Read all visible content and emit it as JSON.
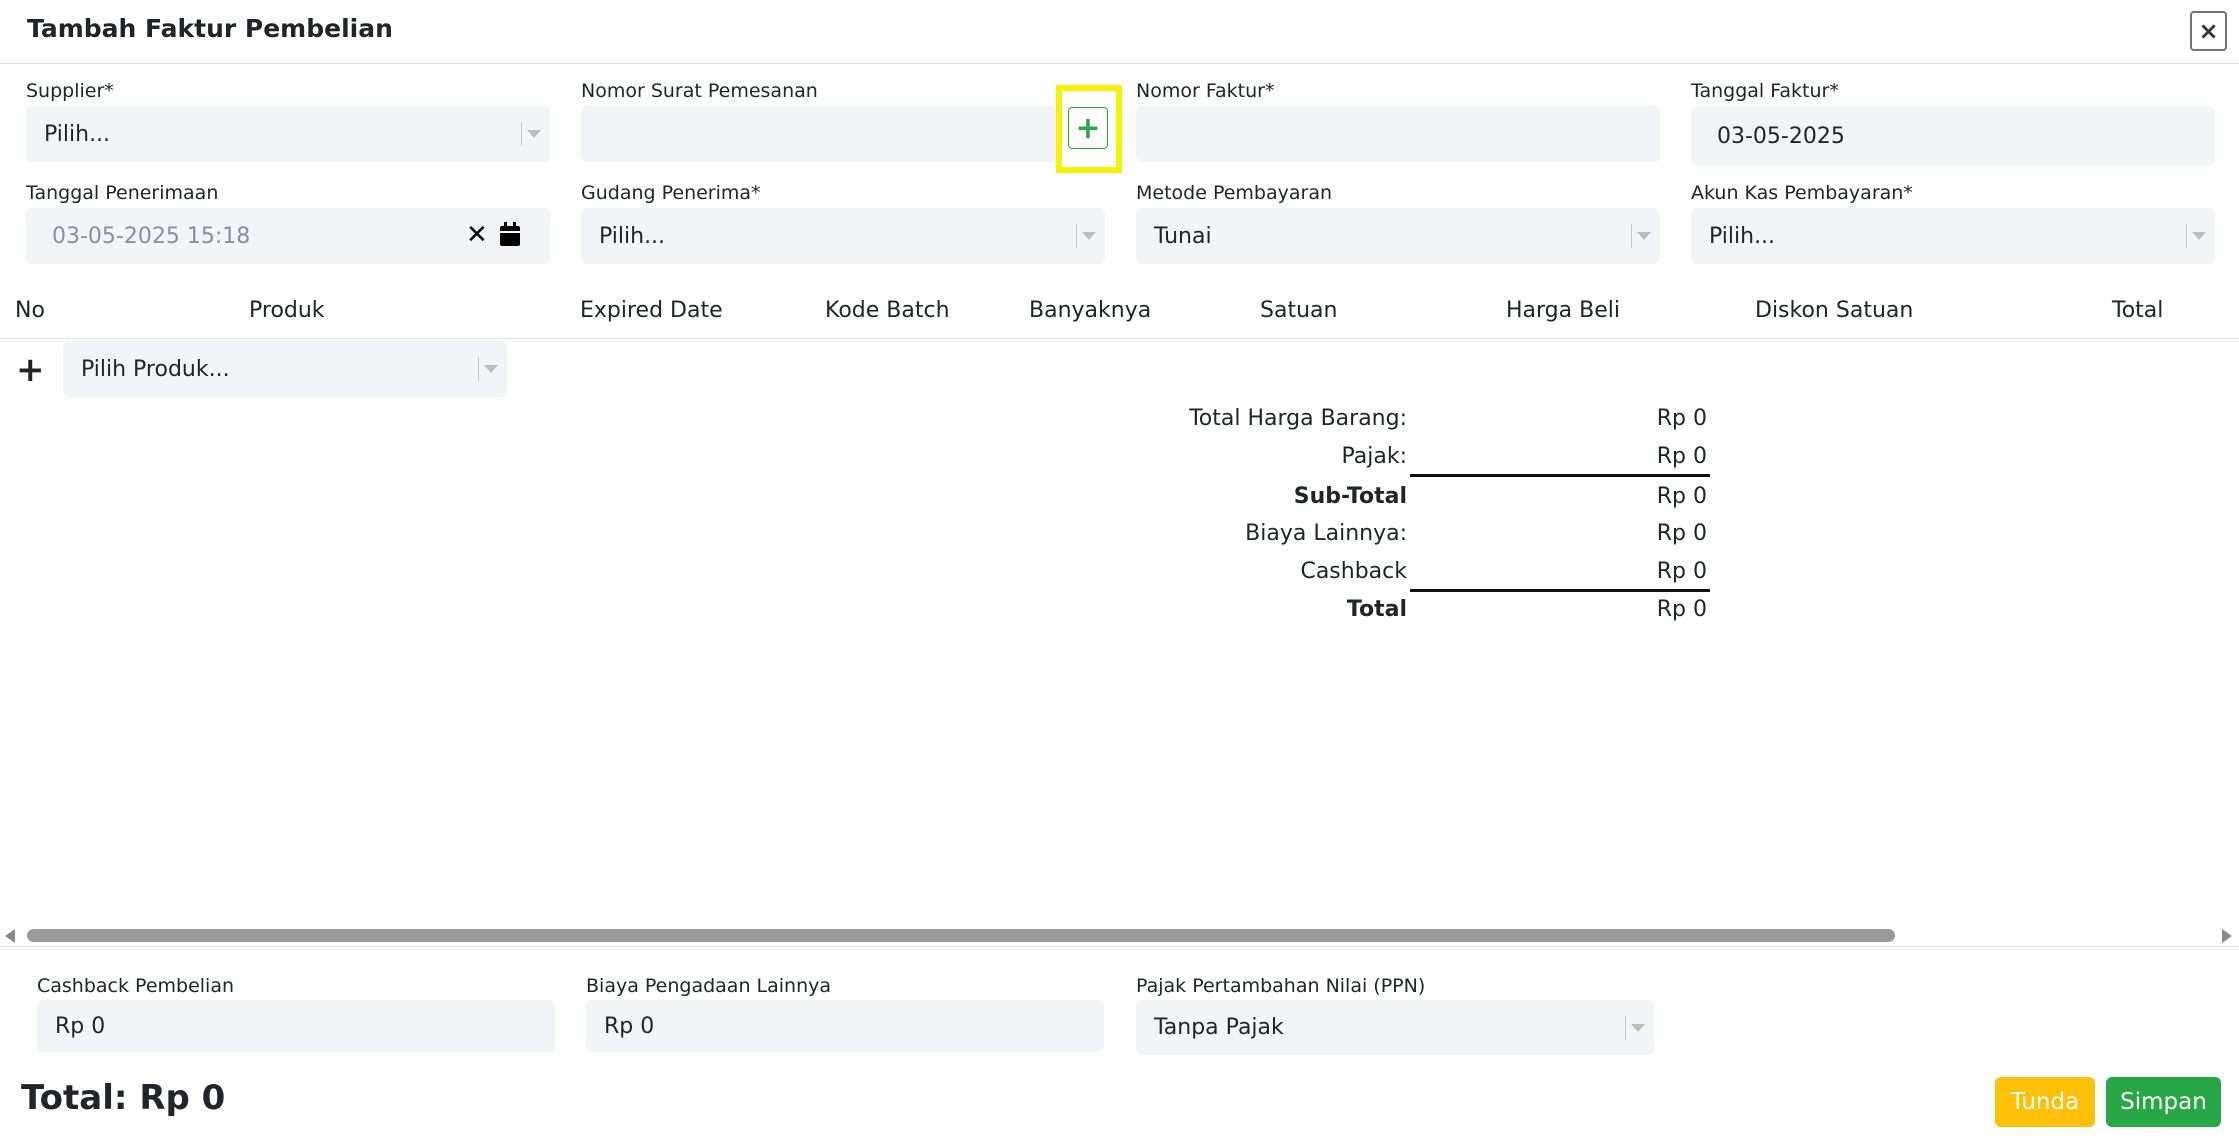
{
  "header": {
    "title": "Tambah Faktur Pembelian",
    "close_icon": "close-icon"
  },
  "form": {
    "supplier": {
      "label": "Supplier*",
      "value": "Pilih..."
    },
    "nomor_surat": {
      "label": "Nomor Surat Pemesanan",
      "value": "",
      "add_label": "+"
    },
    "nomor_faktur": {
      "label": "Nomor Faktur*",
      "value": ""
    },
    "tanggal_faktur": {
      "label": "Tanggal Faktur*",
      "value": "03-05-2025"
    },
    "tanggal_penerimaan": {
      "label": "Tanggal Penerimaan",
      "value": "03-05-2025 15:18",
      "clear_icon": "close-icon",
      "calendar_icon": "calendar-icon"
    },
    "gudang": {
      "label": "Gudang Penerima*",
      "value": "Pilih..."
    },
    "metode": {
      "label": "Metode Pembayaran",
      "value": "Tunai"
    },
    "akun_kas": {
      "label": "Akun Kas Pembayaran*",
      "value": "Pilih..."
    }
  },
  "table": {
    "columns": [
      "No",
      "Produk",
      "Expired Date",
      "Kode Batch",
      "Banyaknya",
      "Satuan",
      "Harga Beli",
      "Diskon Satuan",
      "Total"
    ],
    "add_row_label": "+",
    "product_select": "Pilih Produk..."
  },
  "summary": [
    {
      "label": "Total Harga Barang:",
      "value": "Rp 0"
    },
    {
      "label": "Pajak:",
      "value": "Rp 0"
    },
    {
      "label": "Sub-Total",
      "value": "Rp 0"
    },
    {
      "label": "Biaya Lainnya:",
      "value": "Rp 0"
    },
    {
      "label": "Cashback",
      "value": "Rp 0"
    },
    {
      "label": "Total",
      "value": "Rp 0"
    }
  ],
  "footer": {
    "cashback": {
      "label": "Cashback Pembelian",
      "value": "Rp 0"
    },
    "biaya": {
      "label": "Biaya Pengadaan Lainnya",
      "value": "Rp 0"
    },
    "ppn": {
      "label": "Pajak Pertambahan Nilai (PPN)",
      "value": "Tanpa Pajak"
    },
    "grand_total": "Total: Rp 0",
    "tunda_label": "Tunda",
    "simpan_label": "Simpan"
  },
  "colors": {
    "accent_green": "#28a745",
    "warning_yellow": "#ffc107",
    "highlight": "#f7f203",
    "field_bg": "#f3f4f7"
  }
}
